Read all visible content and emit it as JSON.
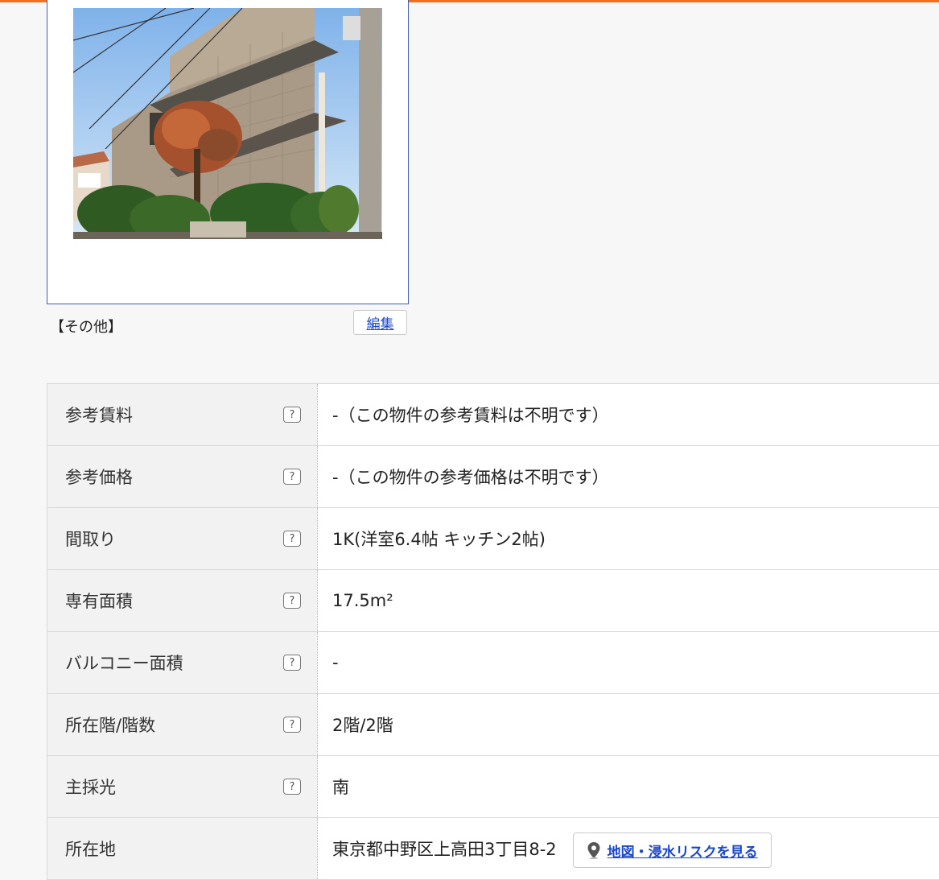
{
  "photo": {
    "caption": "【その他】",
    "edit_label": "編集"
  },
  "specs": [
    {
      "label": "参考賃料",
      "help": "?",
      "value": "-（この物件の参考賃料は不明です）"
    },
    {
      "label": "参考価格",
      "help": "?",
      "value": "-（この物件の参考価格は不明です）"
    },
    {
      "label": "間取り",
      "help": "?",
      "value": "1K(洋室6.4帖 キッチン2帖)"
    },
    {
      "label": "専有面積",
      "help": "?",
      "value": "17.5m²"
    },
    {
      "label": "バルコニー面積",
      "help": "?",
      "value": "-"
    },
    {
      "label": "所在階/階数",
      "help": "?",
      "value": "2階/2階"
    },
    {
      "label": "主採光",
      "help": "?",
      "value": "南"
    },
    {
      "label": "所在地",
      "value": "東京都中野区上高田3丁目8-2",
      "map_link": "地図・浸水リスクを見る"
    }
  ],
  "colors": {
    "accent": "#f0701e",
    "link": "#1a46c8",
    "label_bg": "#f2f2f2"
  }
}
